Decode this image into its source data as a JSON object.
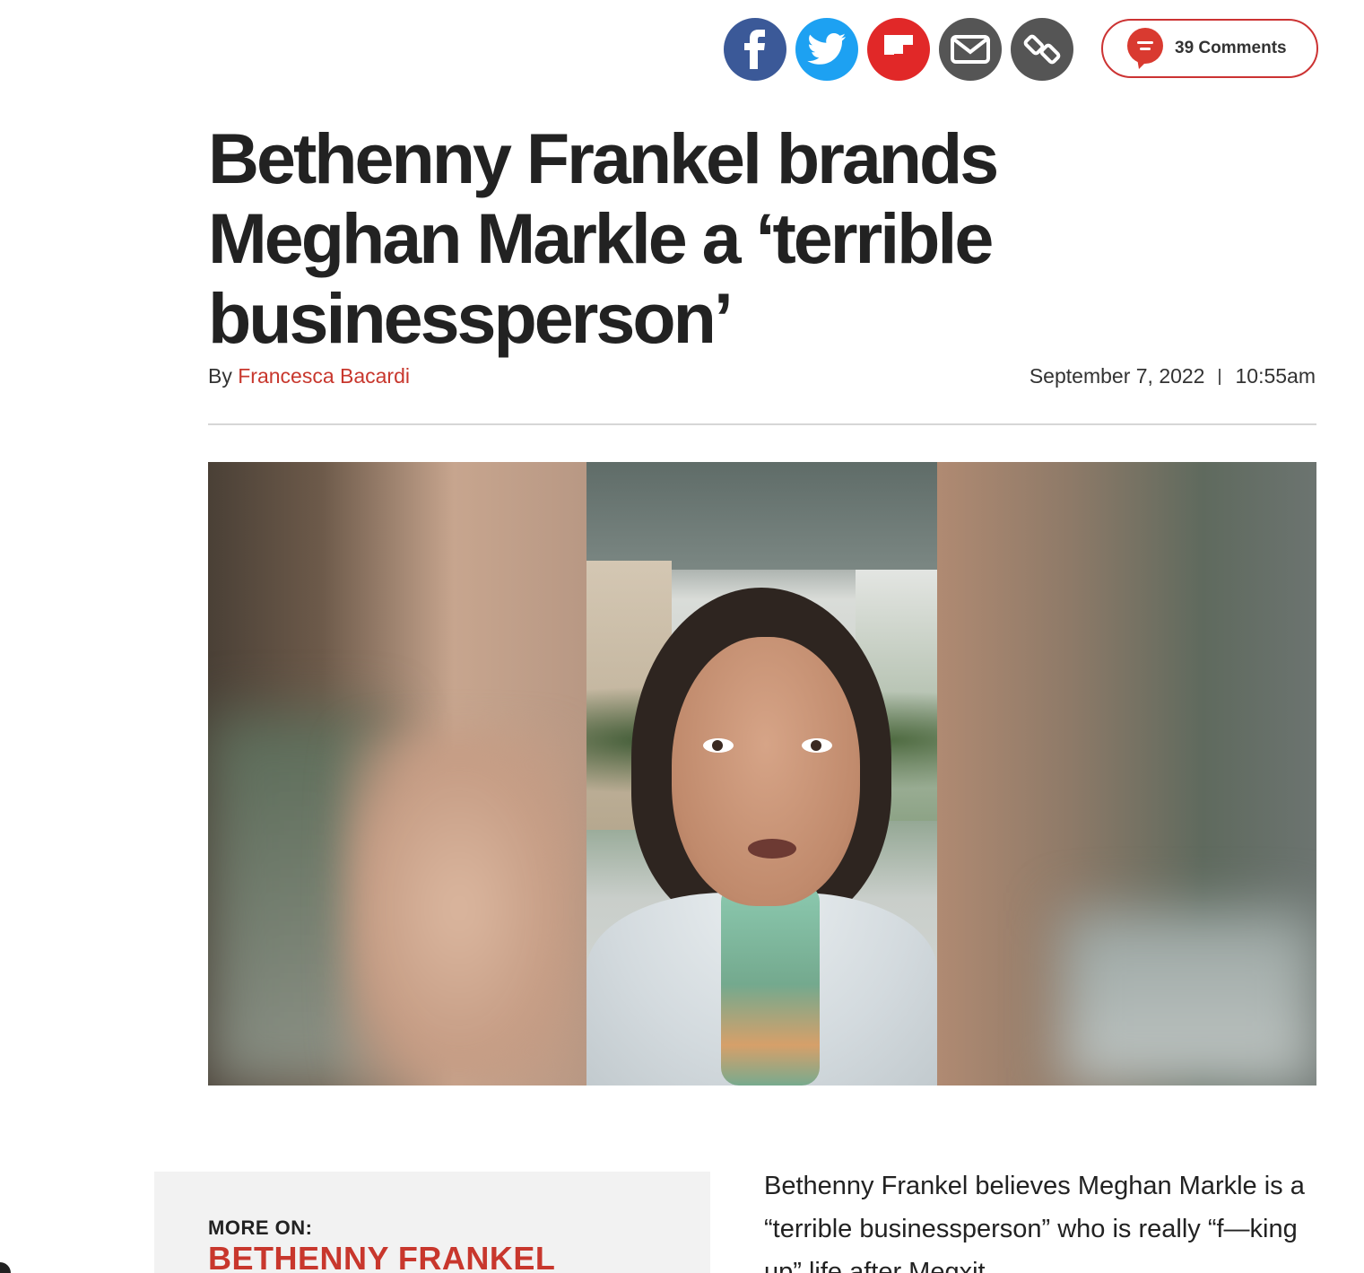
{
  "share": {
    "buttons": [
      {
        "name": "facebook",
        "color": "#3b5998",
        "icon": "facebook-icon"
      },
      {
        "name": "twitter",
        "color": "#1da1f2",
        "icon": "twitter-icon"
      },
      {
        "name": "flipboard",
        "color": "#e12828",
        "icon": "flipboard-icon"
      },
      {
        "name": "email",
        "color": "#555555",
        "icon": "mail-icon"
      },
      {
        "name": "link",
        "color": "#555555",
        "icon": "link-icon"
      }
    ]
  },
  "comments": {
    "label": "39 Comments",
    "icon": "comment-bubble-icon",
    "accent": "#cc3333"
  },
  "article": {
    "headline": "Bethenny Frankel brands Meghan Markle a ‘terrible businessperson’",
    "byline_prefix": "By",
    "author": "Francesca Bacardi",
    "date": "September 7, 2022",
    "time": "10:55am",
    "body": "Bethenny Frankel believes Meghan Markle is a “terrible businessperson” who is really “f—king up” life after Megxit."
  },
  "sidebar": {
    "kicker": "MORE ON:",
    "topic": "BETHENNY FRANKEL"
  },
  "colors": {
    "accent_red": "#c8372d",
    "text": "#222222",
    "rule": "#d6d6d6"
  }
}
